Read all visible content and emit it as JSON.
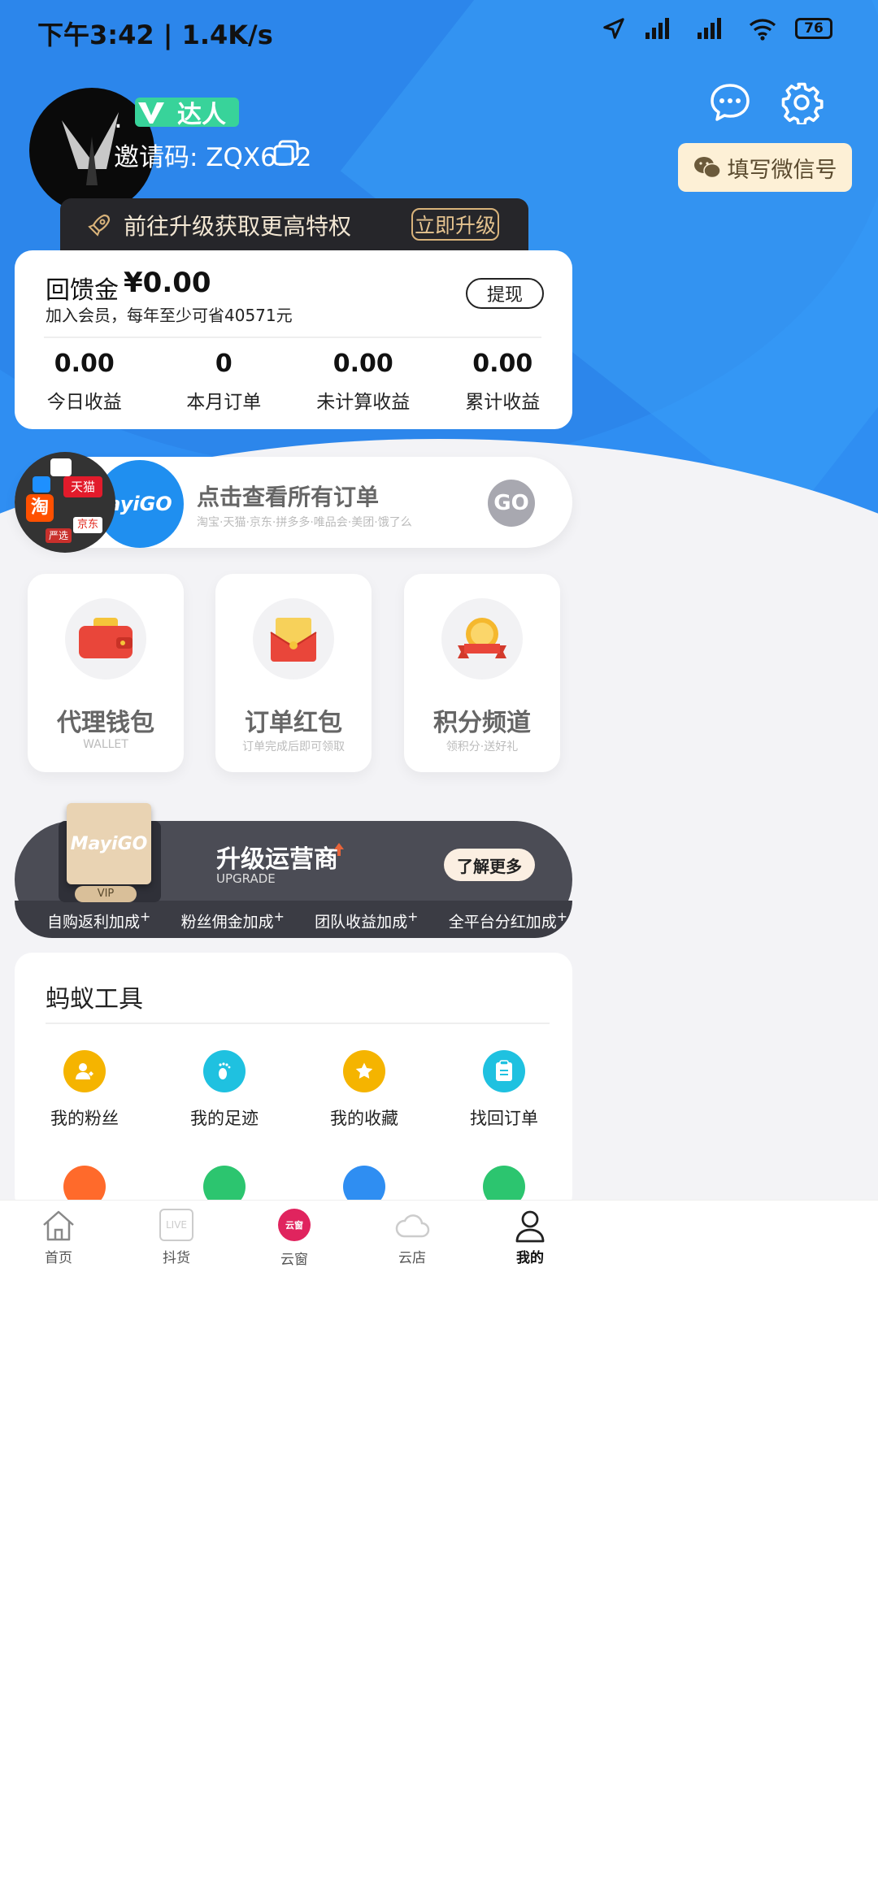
{
  "status_bar": {
    "time_speed": "下午3:42 | 1.4K/s",
    "battery": "76"
  },
  "profile": {
    "name": ".",
    "badge": "达人",
    "invite_label": "邀请码: ZQX6D2",
    "wechat_button": "填写微信号"
  },
  "upgrade_banner": {
    "text": "前往升级获取更高特权",
    "button": "立即升级"
  },
  "rebate": {
    "title": "回馈金",
    "amount": "¥0.00",
    "subtitle": "加入会员，每年至少可省40571元",
    "withdraw": "提现",
    "stats": [
      {
        "value": "0.00",
        "label": "今日收益"
      },
      {
        "value": "0",
        "label": "本月订单"
      },
      {
        "value": "0.00",
        "label": "未计算收益"
      },
      {
        "value": "0.00",
        "label": "累计收益"
      }
    ]
  },
  "orders": {
    "title": "点击查看所有订单",
    "platforms": "淘宝·天猫·京东·拼多多·唯品会·美团·饿了么",
    "go": "GO",
    "brand": "ayiGO",
    "app_tiles": [
      "淘",
      "天猫",
      "京东",
      "严选"
    ]
  },
  "features": [
    {
      "title": "代理钱包",
      "sub": "WALLET"
    },
    {
      "title": "订单红包",
      "sub": "订单完成后即可领取"
    },
    {
      "title": "积分频道",
      "sub": "领积分·送好礼"
    }
  ],
  "operator": {
    "title": "升级运营商",
    "sub": "UPGRADE",
    "button": "了解更多",
    "card_brand": "MayiGO",
    "vip": "VIP",
    "perks": [
      "自购返利加成",
      "粉丝佣金加成",
      "团队收益加成",
      "全平台分红加成"
    ],
    "plus": "+"
  },
  "tools": {
    "title": "蚂蚁工具",
    "items": [
      {
        "label": "我的粉丝",
        "icon": "fans-icon",
        "color": "#f5b400"
      },
      {
        "label": "我的足迹",
        "icon": "footprint-icon",
        "color": "#1fc1e0"
      },
      {
        "label": "我的收藏",
        "icon": "star-icon",
        "color": "#f5b400"
      },
      {
        "label": "找回订单",
        "icon": "clipboard-icon",
        "color": "#1fc1e0"
      }
    ],
    "row2_colors": [
      "#ff6a2b",
      "#2cc56f",
      "#2f8ef2",
      "#2cc56f"
    ]
  },
  "bottom_nav": [
    {
      "label": "首页",
      "icon": "home-icon"
    },
    {
      "label": "抖货",
      "icon": "live-icon",
      "icon_text": "LIVE"
    },
    {
      "label": "云窗",
      "icon": "yunchuang-icon",
      "icon_text": "云窗"
    },
    {
      "label": "云店",
      "icon": "cloud-icon"
    },
    {
      "label": "我的",
      "icon": "profile-icon"
    }
  ]
}
